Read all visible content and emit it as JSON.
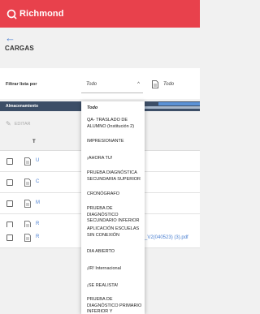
{
  "header": {
    "brand": "Richmond",
    "brand_color": "#e8414c"
  },
  "page": {
    "back_icon": "arrow-left-icon",
    "title": "CARGAS"
  },
  "filter": {
    "label": "Filtrar lista por",
    "primary_value": "Todo",
    "secondary_value": "Todo"
  },
  "storage": {
    "label": "Almacenamiento"
  },
  "toolbar": {
    "edit_label": "EDITAR"
  },
  "table": {
    "column_letter": "T",
    "rows": [
      {
        "tag": "U"
      },
      {
        "tag": "C"
      },
      {
        "tag": "M"
      },
      {
        "tag": "R"
      },
      {
        "tag": "R"
      }
    ],
    "visible_filename": "_V2(040523) (3).pdf"
  },
  "dropdown": {
    "items": [
      "Todo",
      "QA- TRASLADO DE ALUMNO (Institución 2)",
      "IMPRESIONANTE",
      "¡AHORA TU!",
      "PRUEBA DIAGNÓSTICA SECUNDARIA SUPERIOR",
      "CRONÓGRAFO",
      "PRUEBA DE DIAGNÓSTICO SECUNDARIO INFERIOR",
      "APLICACIÓN ESCUELAS SIN CONEXIÓN",
      "DIA ABIERTO",
      "¡IR! Internacional",
      "¡SE REALISTA!",
      "PRUEBA DE DIAGNÓSTICO PRIMARIO INFERIOR Y"
    ]
  }
}
